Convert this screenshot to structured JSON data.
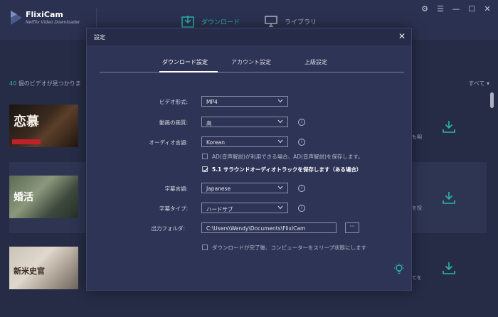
{
  "app": {
    "name": "FlixiCam",
    "subtitle": "Netflix Video Downloader"
  },
  "nav": {
    "download": "ダウンロード",
    "library": "ライブラリ"
  },
  "window_controls": [
    "⚙",
    "☰",
    "—",
    "☐",
    "✕"
  ],
  "list": {
    "found_count": "40",
    "found_text": " 個のビデオが見つかりま",
    "filter": "すべて ▾",
    "rows": [
      {
        "thumb_title": "恋慕",
        "tail": "にも明"
      },
      {
        "thumb_title": "婚活",
        "tail": "生を探"
      },
      {
        "thumb_title": "新米史官",
        "tail": "べてを"
      }
    ]
  },
  "modal": {
    "title": "設定",
    "close": "✕",
    "tabs": [
      "ダウンロード設定",
      "アカウント設定",
      "上級設定"
    ],
    "video_format": {
      "label": "ビデオ形式:",
      "value": "MP4"
    },
    "video_quality": {
      "label": "動画の画質:",
      "value": "高"
    },
    "audio_language": {
      "label": "オーディオ言語:",
      "value": "Korean"
    },
    "ad_option": "AD(音声解説)が利用できる場合、AD(音声解説)を保存します。",
    "surround_option": "5.1 サラウンドオーディオトラックを保存します（ある場合）",
    "subtitle_language": {
      "label": "字幕言語:",
      "value": "Japanese"
    },
    "subtitle_type": {
      "label": "字幕タイプ:",
      "value": "ハードサブ"
    },
    "output_folder": {
      "label": "出力フォルダ:",
      "value": "C:\\Users\\Wendy\\Documents\\FlixiCam",
      "browse": "···"
    },
    "sleep_option": "ダウンロードが完了後、コンピューターをスリープ状態にします",
    "info_glyph": "i"
  },
  "colors": {
    "accent": "#2bb5a6",
    "background": "#262c46",
    "modal": "#2d3455"
  }
}
